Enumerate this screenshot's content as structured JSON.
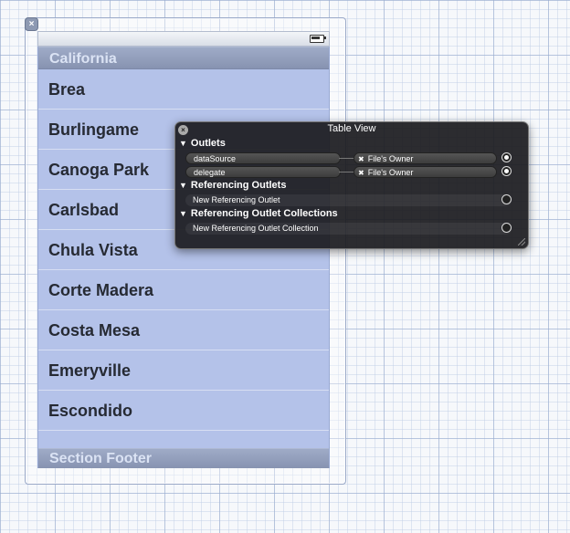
{
  "table": {
    "section_header": "California",
    "rows": [
      "Brea",
      "Burlingame",
      "Canoga Park",
      "Carlsbad",
      "Chula Vista",
      "Corte Madera",
      "Costa Mesa",
      "Emeryville",
      "Escondido"
    ],
    "section_footer": "Section Footer"
  },
  "hud": {
    "title": "Table View",
    "outlets": {
      "heading": "Outlets",
      "items": [
        {
          "name": "dataSource",
          "target": "File's Owner"
        },
        {
          "name": "delegate",
          "target": "File's Owner"
        }
      ]
    },
    "referencing_outlets": {
      "heading": "Referencing Outlets",
      "item": "New Referencing Outlet"
    },
    "referencing_collections": {
      "heading": "Referencing Outlet Collections",
      "item": "New Referencing Outlet Collection"
    }
  },
  "icons": {
    "view_close": "close-icon",
    "battery": "battery-icon",
    "hud_close": "close-icon",
    "disclosure": "triangle-down-icon",
    "connection": "circle-icon",
    "remove_connection": "x-icon",
    "resize": "resize-grip-icon"
  },
  "colors": {
    "table_background": "#b4c2e9",
    "section_header": "#8f9bb8",
    "hud_background": "#1c1c20"
  }
}
